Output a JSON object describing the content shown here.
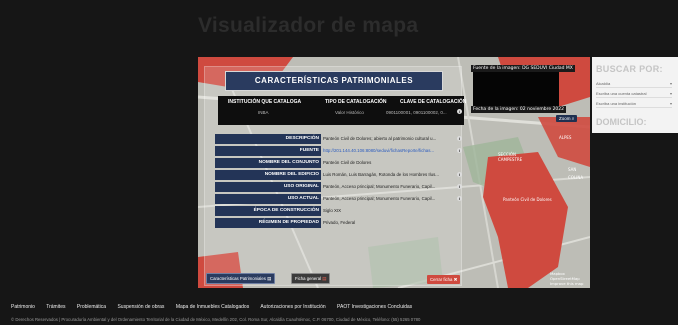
{
  "page": {
    "title": "Visualizador de mapa"
  },
  "map": {
    "image_source": "Fuente de la imagen: DG SEDUVI Ciudad MX",
    "image_date": "Fecha de la imagen: 02 noviembre 2022",
    "zoom_label": "Zoom",
    "legend": [
      "Mapbox",
      "OpenStreetMap",
      "Improve this map"
    ],
    "place_labels": [
      "ALPES",
      "SAN",
      "COLINA",
      "SECCIÓN",
      "CAMPESTRE",
      "Panteón Civil de Dolores"
    ],
    "colors": {
      "polygon_red": "#cf4a3f",
      "card_header": "#2a3b5f",
      "row_label": "#233457"
    }
  },
  "card": {
    "title": "CARACTERÍSTICAS PATRIMONIALES",
    "institution_table": {
      "headers": [
        "INSTITUCIÓN QUE CATALOGA",
        "TIPO DE CATALOGACIÓN",
        "CLAVE DE CATALOGACIÓN"
      ],
      "values": [
        "INBA",
        "Valor Histórico",
        "0901100001, 0901100002, 0..."
      ]
    },
    "rows": [
      {
        "label": "DESCRIPCIÓN",
        "value": "Panteón Civil de Dolores; abierto al patrimonio cultural u..."
      },
      {
        "label": "FUENTE",
        "value": "http://201.144.40.106:8080/seduvi/fichasReporte/fichas..."
      },
      {
        "label": "NOMBRE DEL CONJUNTO",
        "value": "Panteón Civil de Dolores"
      },
      {
        "label": "NOMBRE DEL EDIFICIO",
        "value": "Luis Román, Luis Barragán, Rotonda de los Hombres Ilus..."
      },
      {
        "label": "USO ORIGINAL",
        "value": "Panteón, Acceso principal; Monumento Funerario, Capil..."
      },
      {
        "label": "USO ACTUAL",
        "value": "Panteón, Acceso principal; Monumento Funerario, Capil..."
      },
      {
        "label": "ÉPOCA DE CONSTRUCCIÓN",
        "value": "Siglo XIX"
      },
      {
        "label": "RÉGIMEN DE PROPIEDAD",
        "value": "Privado, Federal"
      }
    ],
    "buttons": {
      "patrimonial": "Características Patrimoniales",
      "general": "Ficha general",
      "close": "Cerrar ficha"
    }
  },
  "search_panel": {
    "title": "BUSCAR POR:",
    "options": [
      "Alcaldía",
      "Escriba una cuenta catastral",
      "Escriba una institución"
    ],
    "domicilio": "DOMICILIO:"
  },
  "footer": {
    "links": [
      "Patrimonio",
      "Trámites",
      "Problemática",
      "Suspensión de obras",
      "Mapa de Inmuebles Catalogados",
      "Autorizaciones por Institución",
      "PAOT Investigaciones Concluidas"
    ],
    "copyright": "© Derechos Reservados | Procuraduría Ambiental y del Ordenamiento Territorial de la Ciudad de México, Medellín 202, Col. Roma Sur, Alcaldía Cuauhtémoc, C.P. 06700, Ciudad de México, Teléfono: (55) 5265 0780"
  }
}
